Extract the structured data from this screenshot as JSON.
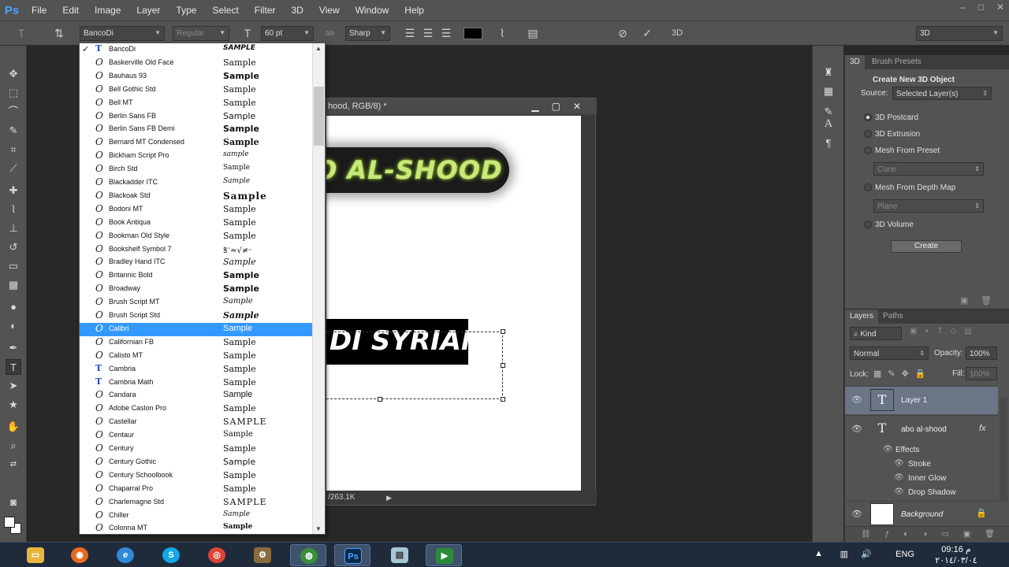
{
  "menubar": {
    "logo": "Ps",
    "items": [
      "File",
      "Edit",
      "Image",
      "Layer",
      "Type",
      "Select",
      "Filter",
      "3D",
      "View",
      "Window",
      "Help"
    ],
    "window_controls": [
      "–",
      "□",
      "✕"
    ]
  },
  "options": {
    "font_family": "BancoDi",
    "font_style": "Regular",
    "font_size": "60 pt",
    "antialias": "Sharp",
    "aa_label": "aa",
    "workspace": "3D",
    "3d_label": "3D"
  },
  "document": {
    "title": "hood, RGB/8) *",
    "status": "/263.1K",
    "glow_text": "O AL-SHOOD",
    "black_text": "DI SYRIAN"
  },
  "font_list": {
    "items": [
      {
        "name": "BancoDi",
        "sample": "SAMPLE",
        "type": "tt",
        "checked": true
      },
      {
        "name": "Baskerville Old Face",
        "sample": "Sample",
        "type": "o"
      },
      {
        "name": "Bauhaus 93",
        "sample": "Sample",
        "type": "o"
      },
      {
        "name": "Bell Gothic Std",
        "sample": "Sample",
        "type": "o"
      },
      {
        "name": "Bell MT",
        "sample": "Sample",
        "type": "o"
      },
      {
        "name": "Berlin Sans FB",
        "sample": "Sample",
        "type": "o"
      },
      {
        "name": "Berlin Sans FB Demi",
        "sample": "Sample",
        "type": "o"
      },
      {
        "name": "Bernard MT Condensed",
        "sample": "Sample",
        "type": "o"
      },
      {
        "name": "Bickham Script Pro",
        "sample": "sample",
        "type": "o"
      },
      {
        "name": "Birch Std",
        "sample": "Sample",
        "type": "o"
      },
      {
        "name": "Blackadder ITC",
        "sample": "Sample",
        "type": "o"
      },
      {
        "name": "Blackoak Std",
        "sample": "Sample",
        "type": "o"
      },
      {
        "name": "Bodoni MT",
        "sample": "Sample",
        "type": "o"
      },
      {
        "name": "Book Antiqua",
        "sample": "Sample",
        "type": "o"
      },
      {
        "name": "Bookman Old Style",
        "sample": "Sample",
        "type": "o"
      },
      {
        "name": "Bookshelf Symbol 7",
        "sample": "ꝸᵔ≈√≠ᵕ",
        "type": "o"
      },
      {
        "name": "Bradley Hand ITC",
        "sample": "Sample",
        "type": "o"
      },
      {
        "name": "Britannic Bold",
        "sample": "Sample",
        "type": "o"
      },
      {
        "name": "Broadway",
        "sample": "Sample",
        "type": "o"
      },
      {
        "name": "Brush Script MT",
        "sample": "Sample",
        "type": "o"
      },
      {
        "name": "Brush Script Std",
        "sample": "Sample",
        "type": "o"
      },
      {
        "name": "Calibri",
        "sample": "Sample",
        "type": "o",
        "selected": true
      },
      {
        "name": "Californian FB",
        "sample": "Sample",
        "type": "o"
      },
      {
        "name": "Calisto MT",
        "sample": "Sample",
        "type": "o"
      },
      {
        "name": "Cambria",
        "sample": "Sample",
        "type": "tt"
      },
      {
        "name": "Cambria Math",
        "sample": "Sample",
        "type": "tt"
      },
      {
        "name": "Candara",
        "sample": "Sample",
        "type": "o"
      },
      {
        "name": "Adobe Caslon Pro",
        "sample": "Sample",
        "type": "o"
      },
      {
        "name": "Castellar",
        "sample": "SAMPLE",
        "type": "o"
      },
      {
        "name": "Centaur",
        "sample": "Sample",
        "type": "o"
      },
      {
        "name": "Century",
        "sample": "Sample",
        "type": "o"
      },
      {
        "name": "Century Gothic",
        "sample": "Sample",
        "type": "o"
      },
      {
        "name": "Century Schoolbook",
        "sample": "Sample",
        "type": "o"
      },
      {
        "name": "Chaparral Pro",
        "sample": "Sample",
        "type": "o"
      },
      {
        "name": "Charlemagne Std",
        "sample": "SAMPLE",
        "type": "o"
      },
      {
        "name": "Chiller",
        "sample": "Sample",
        "type": "o"
      },
      {
        "name": "Colonna MT",
        "sample": "Sample",
        "type": "o"
      }
    ]
  },
  "panel3d": {
    "tabs": [
      "3D",
      "Brush Presets"
    ],
    "title": "Create New 3D Object",
    "source_label": "Source:",
    "source_value": "Selected Layer(s)",
    "options": [
      "3D Postcard",
      "3D Extrusion",
      "Mesh From Preset",
      "Mesh From Depth Map",
      "3D Volume"
    ],
    "preset_value": "Cone",
    "depth_value": "Plane",
    "create_label": "Create"
  },
  "layers": {
    "tabs": [
      "Layers",
      "Paths"
    ],
    "kind_label": "Kind",
    "blend_mode": "Normal",
    "opacity_label": "Opacity:",
    "opacity_value": "100%",
    "lock_label": "Lock:",
    "fill_label": "Fill:",
    "fill_value": "100%",
    "layer1": "Layer 1",
    "text_layer": "abo al-shood",
    "fx": "fx",
    "effects_label": "Effects",
    "effects": [
      "Stroke",
      "Inner Glow",
      "Drop Shadow"
    ],
    "background": "Background"
  },
  "taskbar": {
    "lang": "ENG",
    "time": "09:16 م",
    "date": "٢٠١٤/٠٣/٠٤"
  },
  "colors": {
    "accent_selection": "#3399ff",
    "ui_gray": "#535353",
    "workspace": "#282828"
  }
}
